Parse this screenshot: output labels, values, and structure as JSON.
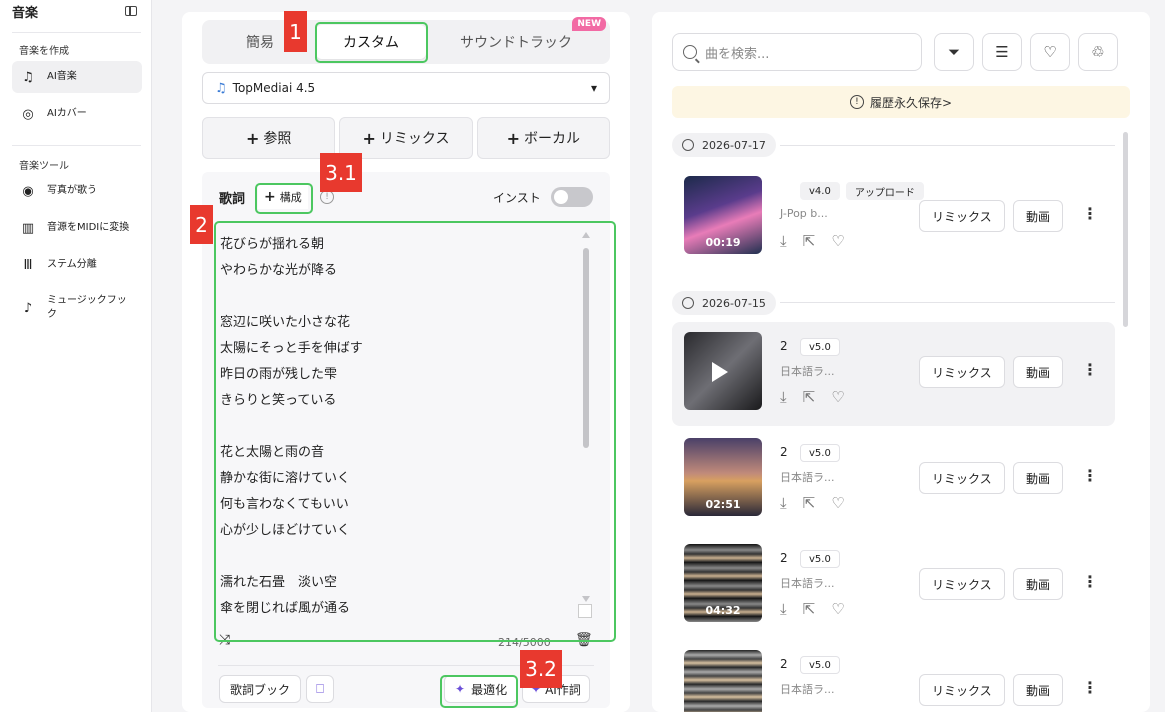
{
  "sidebar": {
    "title": "音楽",
    "section_create": "音楽を作成",
    "section_tools": "音楽ツール",
    "items": [
      {
        "label": "AI音楽",
        "icon": "music-note-icon"
      },
      {
        "label": "AIカバー",
        "icon": "disc-icon"
      },
      {
        "label": "写真が歌う",
        "icon": "lips-icon"
      },
      {
        "label": "音源をMIDIに変換",
        "icon": "piano-icon"
      },
      {
        "label": "ステム分離",
        "icon": "waveform-icon"
      },
      {
        "label": "ミュージックフック",
        "icon": "music-hook-icon"
      }
    ]
  },
  "editor": {
    "tabs": [
      "簡易",
      "カスタム",
      "サウンドトラック"
    ],
    "new_badge": "NEW",
    "model": "TopMediai 4.5",
    "actions": [
      "参照",
      "リミックス",
      "ボーカル"
    ],
    "lyrics_label": "歌詞",
    "structure_label": "構成",
    "instrumental_label": "インスト",
    "lyrics": "花びらが揺れる朝\nやわらかな光が降る\n\n窓辺に咲いた小さな花\n太陽にそっと手を伸ばす\n昨日の雨が残した雫\nきらりと笑っている\n\n花と太陽と雨の音\n静かな街に溶けていく\n何も言わなくてもいい\n心が少しほどけていく\n\n濡れた石畳　淡い空\n傘を閉じれば風が通る",
    "char_count": "214/5000",
    "lyrics_book": "歌詞ブック",
    "optimize": "最適化",
    "ai_lyrics": "AI作詞"
  },
  "annotations": [
    "1",
    "2",
    "3.1",
    "3.2"
  ],
  "library": {
    "search_placeholder": "曲を検索...",
    "notice": "履歴永久保存>",
    "dates": [
      "2026-07-17",
      "2026-07-15"
    ],
    "tracks": [
      {
        "title": "",
        "tags": [
          "v4.0",
          "アップロード"
        ],
        "subtitle": "J-Pop b...",
        "duration": "00:19"
      },
      {
        "title": "2",
        "tags": [
          "v5.0"
        ],
        "subtitle": "日本語ラ...",
        "duration": ""
      },
      {
        "title": "2",
        "tags": [
          "v5.0"
        ],
        "subtitle": "日本語ラ...",
        "duration": "02:51"
      },
      {
        "title": "2",
        "tags": [
          "v5.0"
        ],
        "subtitle": "日本語ラ...",
        "duration": "04:32"
      },
      {
        "title": "2",
        "tags": [
          "v5.0"
        ],
        "subtitle": "日本語ラ...",
        "duration": ""
      }
    ],
    "remix_label": "リミックス",
    "video_label": "動画"
  }
}
